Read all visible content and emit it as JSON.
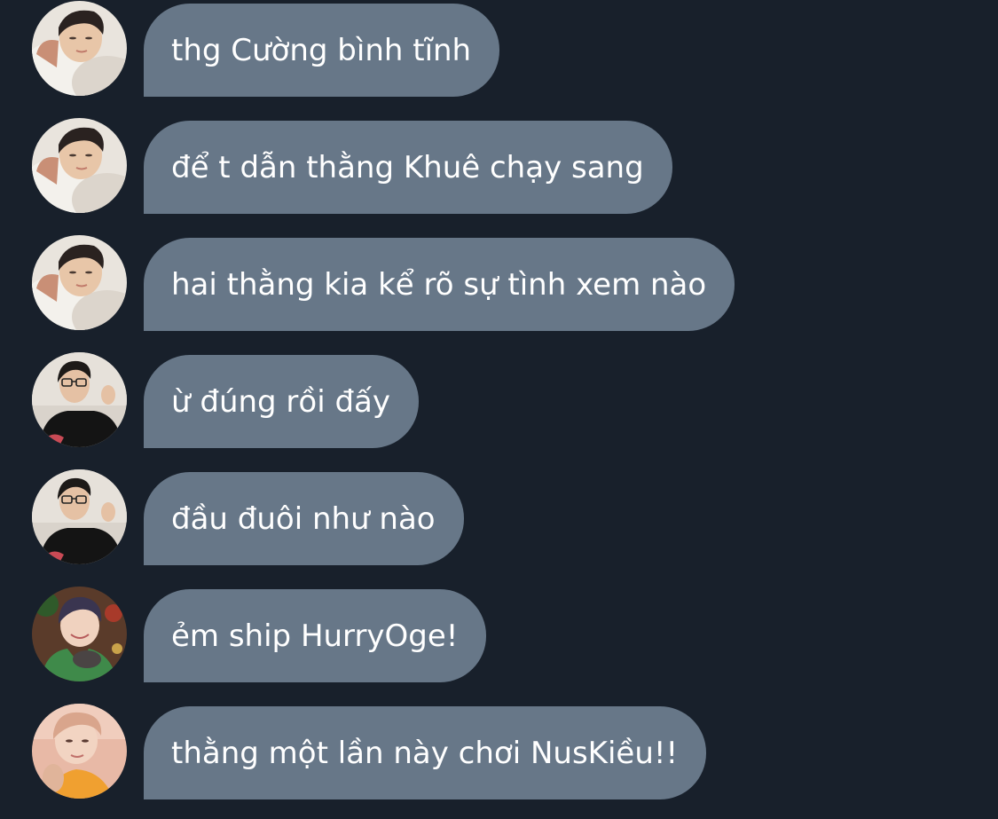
{
  "colors": {
    "background": "#18202b",
    "bubble": "#677788",
    "text": "#ffffff"
  },
  "messages": [
    {
      "avatar": "avatar-user-a",
      "text": "thg Cường bình tĩnh"
    },
    {
      "avatar": "avatar-user-a",
      "text": "để t dẫn thằng Khuê chạy sang"
    },
    {
      "avatar": "avatar-user-a",
      "text": "hai thằng kia kể rõ sự tình xem nào"
    },
    {
      "avatar": "avatar-user-b",
      "text": "ừ đúng rồi đấy"
    },
    {
      "avatar": "avatar-user-b",
      "text": "đầu đuôi như nào"
    },
    {
      "avatar": "avatar-user-c",
      "text": "ẻm ship HurryOge!"
    },
    {
      "avatar": "avatar-user-d",
      "text": "thằng một lần này chơi NusKiều!!"
    }
  ]
}
